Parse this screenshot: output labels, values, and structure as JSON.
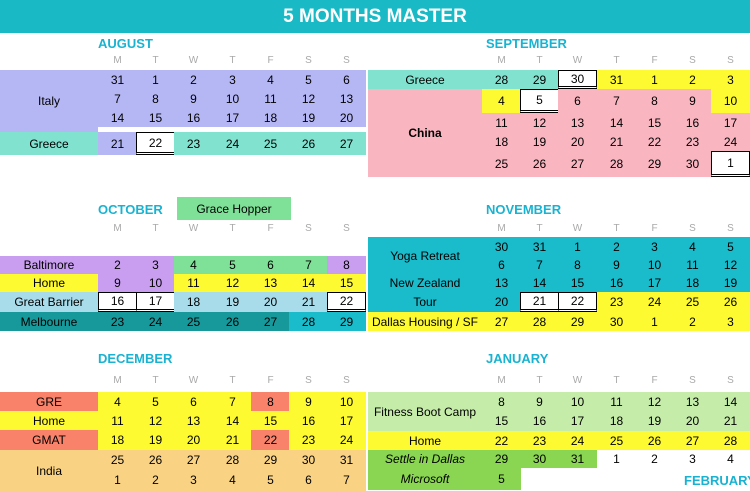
{
  "title": "5 MONTHS MASTER",
  "colors": {
    "header": "#19bac6",
    "month_name": "#19b3d1",
    "lavender": "#b5b7f5",
    "mint": "#80e2cf",
    "pink": "#f9b5c0",
    "yellow": "#fefa32",
    "green": "#7fe098",
    "purple": "#c99ef0",
    "light_blue": "#a8dcea",
    "teal": "#17999c",
    "cyan": "#1abbcb",
    "salmon": "#f8826a",
    "peach": "#f9d383",
    "light_green": "#c5eca9",
    "bright_green": "#8ad551"
  },
  "months": {
    "august": {
      "name": "AUGUST",
      "dow": [
        "M",
        "T",
        "W",
        "T",
        "F",
        "S",
        "S"
      ]
    },
    "september": {
      "name": "SEPTEMBER",
      "dow": [
        "M",
        "T",
        "W",
        "T",
        "F",
        "S",
        "S"
      ]
    },
    "october": {
      "name": "OCTOBER",
      "dow": [
        "M",
        "T",
        "W",
        "T",
        "F",
        "S",
        "S"
      ]
    },
    "november": {
      "name": "NOVEMBER",
      "dow": [
        "M",
        "T",
        "W",
        "T",
        "F",
        "S",
        "S"
      ]
    },
    "december": {
      "name": "DECEMBER",
      "dow": [
        "M",
        "T",
        "W",
        "T",
        "F",
        "S",
        "S"
      ]
    },
    "january": {
      "name": "JANUARY",
      "dow": [
        "M",
        "T",
        "W",
        "T",
        "F",
        "S",
        "S"
      ]
    },
    "february": {
      "name": "FEBRUARY"
    }
  },
  "labels": {
    "grace_hopper": "Grace Hopper",
    "italy": "Italy",
    "greece_aug": "Greece",
    "greece_sep": "Greece",
    "china": "China",
    "baltimore": "Baltimore",
    "home_oct": "Home",
    "great_barrier": "Great Barrier",
    "melbourne": "Melbourne",
    "yoga_retreat": "Yoga Retreat",
    "new_zealand": "New Zealand",
    "tour": "Tour",
    "dallas_housing": "Dallas Housing / SF",
    "gre": "GRE",
    "home_dec": "Home",
    "gmat": "GMAT",
    "india": "India",
    "fitness_boot_camp": "Fitness Boot Camp",
    "home_jan": "Home",
    "settle_in_dallas": "Settle in Dallas",
    "microsoft": "Microsoft"
  },
  "august": [
    [
      {
        "d": "31",
        "c": "lavender"
      },
      {
        "d": "1",
        "c": "lavender"
      },
      {
        "d": "2",
        "c": "lavender"
      },
      {
        "d": "3",
        "c": "lavender"
      },
      {
        "d": "4",
        "c": "lavender"
      },
      {
        "d": "5",
        "c": "lavender"
      },
      {
        "d": "6",
        "c": "lavender"
      }
    ],
    [
      {
        "d": "7",
        "c": "lavender"
      },
      {
        "d": "8",
        "c": "lavender"
      },
      {
        "d": "9",
        "c": "lavender"
      },
      {
        "d": "10",
        "c": "lavender"
      },
      {
        "d": "11",
        "c": "lavender"
      },
      {
        "d": "12",
        "c": "lavender"
      },
      {
        "d": "13",
        "c": "lavender"
      }
    ],
    [
      {
        "d": "14",
        "c": "lavender"
      },
      {
        "d": "15",
        "c": "lavender"
      },
      {
        "d": "16",
        "c": "lavender"
      },
      {
        "d": "17",
        "c": "lavender"
      },
      {
        "d": "18",
        "c": "lavender"
      },
      {
        "d": "19",
        "c": "lavender"
      },
      {
        "d": "20",
        "c": "lavender"
      }
    ],
    [
      {
        "d": "21",
        "c": "lavender"
      },
      {
        "d": "22",
        "c": "white",
        "boxed": true
      },
      {
        "d": "23",
        "c": "mint"
      },
      {
        "d": "24",
        "c": "mint"
      },
      {
        "d": "25",
        "c": "mint"
      },
      {
        "d": "26",
        "c": "mint"
      },
      {
        "d": "27",
        "c": "mint"
      }
    ]
  ],
  "september": [
    [
      {
        "d": "28",
        "c": "mint"
      },
      {
        "d": "29",
        "c": "mint"
      },
      {
        "d": "30",
        "c": "white",
        "boxed": true
      },
      {
        "d": "31",
        "c": "yellow"
      },
      {
        "d": "1",
        "c": "yellow"
      },
      {
        "d": "2",
        "c": "yellow"
      },
      {
        "d": "3",
        "c": "yellow"
      }
    ],
    [
      {
        "d": "4",
        "c": "yellow"
      },
      {
        "d": "5",
        "c": "white",
        "boxed": true
      },
      {
        "d": "6",
        "c": "pink"
      },
      {
        "d": "7",
        "c": "pink"
      },
      {
        "d": "8",
        "c": "pink"
      },
      {
        "d": "9",
        "c": "pink"
      },
      {
        "d": "10",
        "c": "yellow"
      }
    ],
    [
      {
        "d": "11",
        "c": "pink"
      },
      {
        "d": "12",
        "c": "pink"
      },
      {
        "d": "13",
        "c": "pink"
      },
      {
        "d": "14",
        "c": "pink"
      },
      {
        "d": "15",
        "c": "pink"
      },
      {
        "d": "16",
        "c": "pink"
      },
      {
        "d": "17",
        "c": "pink"
      }
    ],
    [
      {
        "d": "18",
        "c": "pink"
      },
      {
        "d": "19",
        "c": "pink"
      },
      {
        "d": "20",
        "c": "pink"
      },
      {
        "d": "21",
        "c": "pink"
      },
      {
        "d": "22",
        "c": "pink"
      },
      {
        "d": "23",
        "c": "pink"
      },
      {
        "d": "24",
        "c": "pink"
      }
    ],
    [
      {
        "d": "25",
        "c": "pink"
      },
      {
        "d": "26",
        "c": "pink"
      },
      {
        "d": "27",
        "c": "pink"
      },
      {
        "d": "28",
        "c": "pink"
      },
      {
        "d": "29",
        "c": "pink"
      },
      {
        "d": "30",
        "c": "pink"
      },
      {
        "d": "1",
        "c": "white",
        "boxed": true
      }
    ]
  ],
  "october": [
    [
      {
        "d": "2",
        "c": "purple"
      },
      {
        "d": "3",
        "c": "purple"
      },
      {
        "d": "4",
        "c": "green"
      },
      {
        "d": "5",
        "c": "green"
      },
      {
        "d": "6",
        "c": "green"
      },
      {
        "d": "7",
        "c": "green"
      },
      {
        "d": "8",
        "c": "purple"
      }
    ],
    [
      {
        "d": "9",
        "c": "purple"
      },
      {
        "d": "10",
        "c": "purple"
      },
      {
        "d": "11",
        "c": "yellow"
      },
      {
        "d": "12",
        "c": "yellow"
      },
      {
        "d": "13",
        "c": "yellow"
      },
      {
        "d": "14",
        "c": "yellow"
      },
      {
        "d": "15",
        "c": "yellow"
      }
    ],
    [
      {
        "d": "16",
        "c": "white",
        "boxed": true
      },
      {
        "d": "17",
        "c": "white",
        "boxed": true
      },
      {
        "d": "18",
        "c": "light_blue"
      },
      {
        "d": "19",
        "c": "light_blue"
      },
      {
        "d": "20",
        "c": "light_blue"
      },
      {
        "d": "21",
        "c": "light_blue"
      },
      {
        "d": "22",
        "c": "white",
        "boxed": true
      }
    ],
    [
      {
        "d": "23",
        "c": "teal"
      },
      {
        "d": "24",
        "c": "teal"
      },
      {
        "d": "25",
        "c": "teal"
      },
      {
        "d": "26",
        "c": "teal"
      },
      {
        "d": "27",
        "c": "teal"
      },
      {
        "d": "28",
        "c": "cyan"
      },
      {
        "d": "29",
        "c": "cyan"
      }
    ]
  ],
  "november": [
    [
      {
        "d": "30",
        "c": "cyan"
      },
      {
        "d": "31",
        "c": "cyan"
      },
      {
        "d": "1",
        "c": "cyan"
      },
      {
        "d": "2",
        "c": "cyan"
      },
      {
        "d": "3",
        "c": "cyan"
      },
      {
        "d": "4",
        "c": "cyan"
      },
      {
        "d": "5",
        "c": "cyan"
      }
    ],
    [
      {
        "d": "6",
        "c": "cyan"
      },
      {
        "d": "7",
        "c": "cyan"
      },
      {
        "d": "8",
        "c": "cyan"
      },
      {
        "d": "9",
        "c": "cyan"
      },
      {
        "d": "10",
        "c": "cyan"
      },
      {
        "d": "11",
        "c": "cyan"
      },
      {
        "d": "12",
        "c": "cyan"
      }
    ],
    [
      {
        "d": "13",
        "c": "cyan"
      },
      {
        "d": "14",
        "c": "cyan"
      },
      {
        "d": "15",
        "c": "cyan"
      },
      {
        "d": "16",
        "c": "cyan"
      },
      {
        "d": "17",
        "c": "cyan"
      },
      {
        "d": "18",
        "c": "cyan"
      },
      {
        "d": "19",
        "c": "cyan"
      }
    ],
    [
      {
        "d": "20",
        "c": "cyan"
      },
      {
        "d": "21",
        "c": "white",
        "boxed": true
      },
      {
        "d": "22",
        "c": "white",
        "boxed": true
      },
      {
        "d": "23",
        "c": "yellow"
      },
      {
        "d": "24",
        "c": "yellow"
      },
      {
        "d": "25",
        "c": "yellow"
      },
      {
        "d": "26",
        "c": "yellow"
      }
    ],
    [
      {
        "d": "27",
        "c": "yellow"
      },
      {
        "d": "28",
        "c": "yellow"
      },
      {
        "d": "29",
        "c": "yellow"
      },
      {
        "d": "30",
        "c": "yellow"
      },
      {
        "d": "1",
        "c": "yellow"
      },
      {
        "d": "2",
        "c": "yellow"
      },
      {
        "d": "3",
        "c": "yellow"
      }
    ]
  ],
  "december": [
    [
      {
        "d": "4",
        "c": "yellow"
      },
      {
        "d": "5",
        "c": "yellow"
      },
      {
        "d": "6",
        "c": "yellow"
      },
      {
        "d": "7",
        "c": "yellow"
      },
      {
        "d": "8",
        "c": "salmon"
      },
      {
        "d": "9",
        "c": "yellow"
      },
      {
        "d": "10",
        "c": "yellow"
      }
    ],
    [
      {
        "d": "11",
        "c": "yellow"
      },
      {
        "d": "12",
        "c": "yellow"
      },
      {
        "d": "13",
        "c": "yellow"
      },
      {
        "d": "14",
        "c": "yellow"
      },
      {
        "d": "15",
        "c": "yellow"
      },
      {
        "d": "16",
        "c": "yellow"
      },
      {
        "d": "17",
        "c": "yellow"
      }
    ],
    [
      {
        "d": "18",
        "c": "yellow"
      },
      {
        "d": "19",
        "c": "yellow"
      },
      {
        "d": "20",
        "c": "yellow"
      },
      {
        "d": "21",
        "c": "yellow"
      },
      {
        "d": "22",
        "c": "salmon"
      },
      {
        "d": "23",
        "c": "yellow"
      },
      {
        "d": "24",
        "c": "yellow"
      }
    ],
    [
      {
        "d": "25",
        "c": "peach"
      },
      {
        "d": "26",
        "c": "peach"
      },
      {
        "d": "27",
        "c": "peach"
      },
      {
        "d": "28",
        "c": "peach"
      },
      {
        "d": "29",
        "c": "peach"
      },
      {
        "d": "30",
        "c": "peach"
      },
      {
        "d": "31",
        "c": "peach"
      }
    ],
    [
      {
        "d": "1",
        "c": "peach"
      },
      {
        "d": "2",
        "c": "peach"
      },
      {
        "d": "3",
        "c": "peach"
      },
      {
        "d": "4",
        "c": "peach"
      },
      {
        "d": "5",
        "c": "peach"
      },
      {
        "d": "6",
        "c": "peach"
      },
      {
        "d": "7",
        "c": "peach"
      }
    ]
  ],
  "january": [
    [
      {
        "d": "8",
        "c": "light_green"
      },
      {
        "d": "9",
        "c": "light_green"
      },
      {
        "d": "10",
        "c": "light_green"
      },
      {
        "d": "11",
        "c": "light_green"
      },
      {
        "d": "12",
        "c": "light_green"
      },
      {
        "d": "13",
        "c": "light_green"
      },
      {
        "d": "14",
        "c": "light_green"
      }
    ],
    [
      {
        "d": "15",
        "c": "light_green"
      },
      {
        "d": "16",
        "c": "light_green"
      },
      {
        "d": "17",
        "c": "light_green"
      },
      {
        "d": "18",
        "c": "light_green"
      },
      {
        "d": "19",
        "c": "light_green"
      },
      {
        "d": "20",
        "c": "light_green"
      },
      {
        "d": "21",
        "c": "light_green"
      }
    ],
    [
      {
        "d": "22",
        "c": "yellow"
      },
      {
        "d": "23",
        "c": "yellow"
      },
      {
        "d": "24",
        "c": "yellow"
      },
      {
        "d": "25",
        "c": "yellow"
      },
      {
        "d": "26",
        "c": "yellow"
      },
      {
        "d": "27",
        "c": "yellow"
      },
      {
        "d": "28",
        "c": "yellow"
      }
    ],
    [
      {
        "d": "29",
        "c": "bright_green"
      },
      {
        "d": "30",
        "c": "bright_green"
      },
      {
        "d": "31",
        "c": "bright_green"
      },
      {
        "d": "1",
        "c": "white"
      },
      {
        "d": "2",
        "c": "white"
      },
      {
        "d": "3",
        "c": "white"
      },
      {
        "d": "4",
        "c": "white"
      }
    ],
    [
      {
        "d": "5",
        "c": "bright_green"
      }
    ]
  ]
}
